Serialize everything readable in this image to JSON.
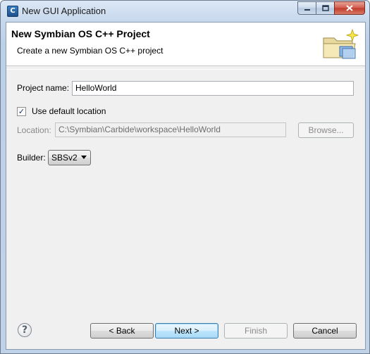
{
  "window": {
    "title": "New GUI Application",
    "app_icon_glyph": "C"
  },
  "banner": {
    "title": "New Symbian OS C++ Project",
    "subtitle": "Create a new Symbian OS C++ project",
    "icon": "folder-sparkle-icon"
  },
  "form": {
    "project_name_label": "Project name:",
    "project_name_value": "HelloWorld",
    "use_default_location_label": "Use default location",
    "use_default_location_checked": true,
    "location_label": "Location:",
    "location_value": "C:\\Symbian\\Carbide\\workspace\\HelloWorld",
    "browse_label": "Browse...",
    "builder_label": "Builder:",
    "builder_value": "SBSv2"
  },
  "footer": {
    "help_glyph": "?",
    "back_label": "< Back",
    "next_label": "Next >",
    "finish_label": "Finish",
    "cancel_label": "Cancel"
  }
}
